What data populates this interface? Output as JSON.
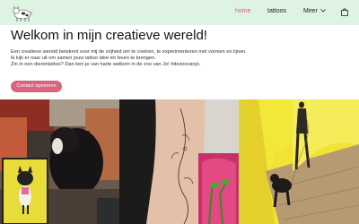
{
  "header": {
    "background": "#dff3e3",
    "logo_icon": "cow-logo-icon",
    "nav": [
      {
        "label": "home",
        "active": true
      },
      {
        "label": "tattoos",
        "active": false
      },
      {
        "label": "Meer",
        "active": false
      }
    ],
    "more_icon": "chevron-down-icon",
    "cart_icon": "shopping-bag-icon",
    "accent": "#e0607a"
  },
  "main": {
    "title": "Welkom in mijn creatieve wereld!",
    "intro": [
      "Een creatieve wereld betekent voor mij de vrijheid om te creëren, te experimenteren met vormen en lijnen.",
      "Ik kijk er naar uit om samen jouw tattoo idee tot leven te brengen.",
      "Zin in een dierentattoo? Dan ben je van harte welkom in de zoo van Jo! #dezoovanjo."
    ],
    "cta_label": "Contact opnemen",
    "cta_color": "#d9647d"
  },
  "gallery": [
    {
      "description_icon": "dog-with-cat-painting-photo"
    },
    {
      "description_icon": "floral-back-tattoo-photo"
    },
    {
      "description_icon": "woman-walking-dog-photo"
    }
  ]
}
